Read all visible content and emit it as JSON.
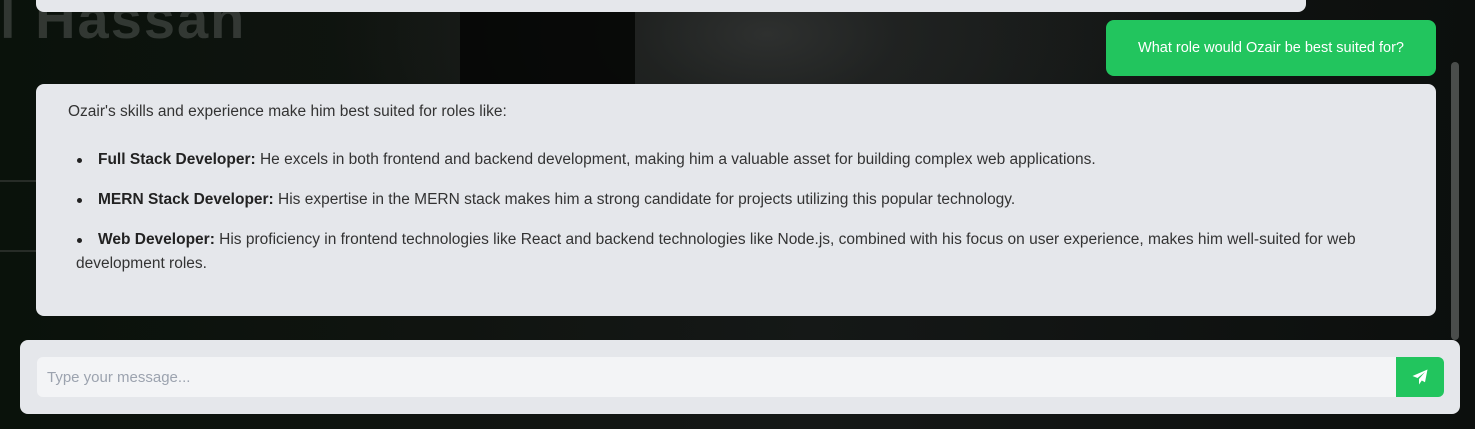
{
  "background": {
    "name_text": "l Hassan"
  },
  "conversation": {
    "user_message": "What role would Ozair be best suited for?",
    "assistant": {
      "intro": "Ozair's skills and experience make him best suited for roles like:",
      "roles": [
        {
          "title": "Full Stack Developer:",
          "description": "He excels in both frontend and backend development, making him a valuable asset for building complex web applications."
        },
        {
          "title": "MERN Stack Developer:",
          "description": "His expertise in the MERN stack makes him a strong candidate for projects utilizing this popular technology."
        },
        {
          "title": "Web Developer:",
          "description": "His proficiency in frontend technologies like React and backend technologies like Node.js, combined with his focus on user experience, makes him well-suited for web development roles."
        }
      ]
    }
  },
  "composer": {
    "placeholder": "Type your message...",
    "value": "",
    "send_icon": "paper-plane-icon"
  },
  "colors": {
    "accent": "#22c55e",
    "bubble_bg": "#e5e7eb",
    "input_bg": "#f3f4f6",
    "page_bg": "#0a0d0a"
  }
}
